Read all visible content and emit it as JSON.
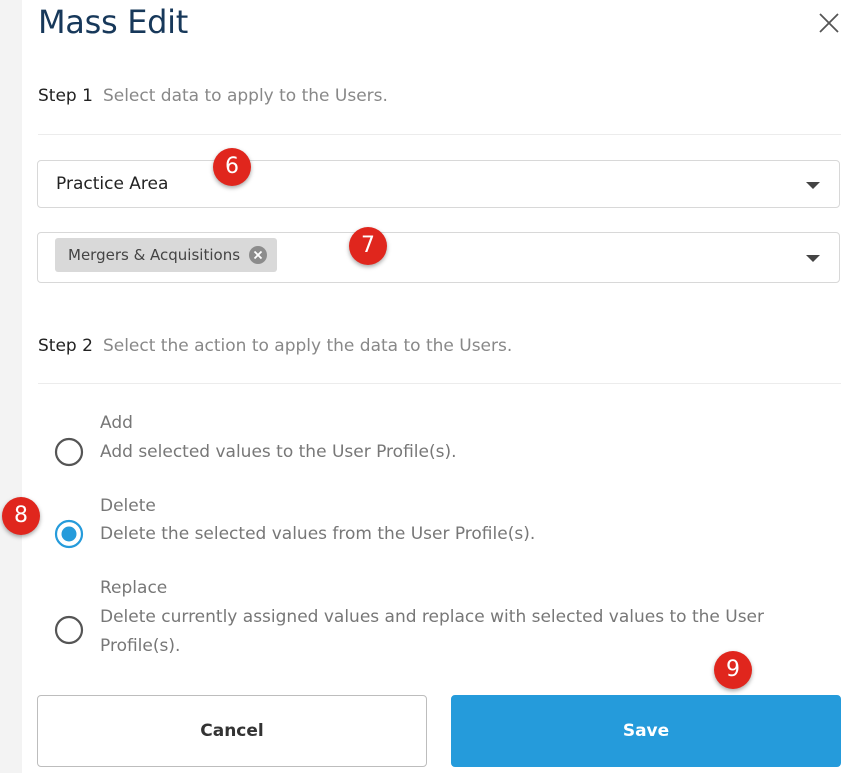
{
  "dialog": {
    "title": "Mass Edit"
  },
  "step1": {
    "number": "Step 1",
    "text": "Select data to apply to the Users."
  },
  "field_select": {
    "value": "Practice Area"
  },
  "values_select": {
    "chips": [
      {
        "label": "Mergers & Acquisitions"
      }
    ]
  },
  "step2": {
    "number": "Step 2",
    "text": "Select the action to apply the data to the Users."
  },
  "actions": [
    {
      "label": "Add",
      "description": "Add selected values to the User Profile(s).",
      "selected": false
    },
    {
      "label": "Delete",
      "description": "Delete the selected values from the User Profile(s).",
      "selected": true
    },
    {
      "label": "Replace",
      "description": "Delete currently assigned values and replace with selected values to the User Profile(s).",
      "selected": false
    }
  ],
  "annotations": [
    "6",
    "7",
    "8",
    "9"
  ],
  "buttons": {
    "cancel": "Cancel",
    "save": "Save"
  },
  "colors": {
    "accent": "#259bdb",
    "title": "#17385a",
    "badge": "#e0261d"
  }
}
